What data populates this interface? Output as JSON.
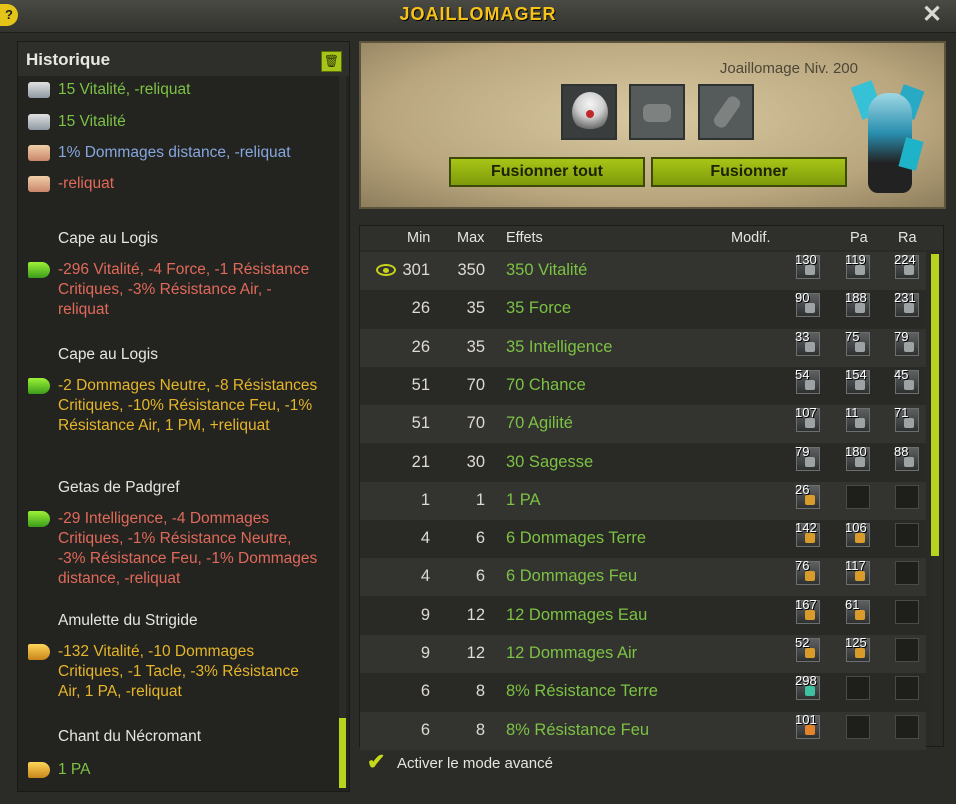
{
  "window": {
    "title": "JOAILLOMAGER",
    "help_icon": "?",
    "close_icon": "✕"
  },
  "history": {
    "title": "Historique",
    "trash_icon": "trash-icon",
    "entries": [
      {
        "icon": "rune-icon",
        "text": "15 Vitalité, -reliquat",
        "color": "#7cc244"
      },
      {
        "icon": "rune-icon",
        "text": "15 Vitalité",
        "color": "#7cc244"
      },
      {
        "icon": "rune-icon",
        "text": "1% Dommages distance, -reliquat",
        "color": "#86a7de"
      },
      {
        "icon": "rune-icon",
        "text": "-reliquat",
        "color": "#e06a5a"
      }
    ],
    "items": [
      {
        "title": "Cape au Logis",
        "text": "-296 Vitalité, -4 Force, -1 Résistance Critiques, -3% Résistance Air, -reliquat",
        "color": "#e06a5a"
      },
      {
        "title": "Cape au Logis",
        "text": "-2 Dommages Neutre, -8 Résistances Critiques, -10% Résistance Feu, -1% Résistance Air, 1 PM, +reliquat",
        "color": "#e5b52a"
      },
      {
        "title": "Getas de Padgref",
        "text": "-29 Intelligence, -4 Dommages Critiques, -1% Résistance Neutre, -3% Résistance Feu, -1% Dommages distance, -reliquat",
        "color": "#e06a5a"
      },
      {
        "title": "Amulette du Strigide",
        "text": "-132 Vitalité, -10 Dommages Critiques, -1 Tacle, -3% Résistance Air, 1 PA, -reliquat",
        "color": "#e5b52a"
      },
      {
        "title": "Chant du Nécromant",
        "text": "1 PA",
        "color": "#7cc244"
      }
    ]
  },
  "craft": {
    "level_label": "Joaillomage Niv. 200",
    "fuse_all_label": "Fusionner tout",
    "fuse_label": "Fusionner"
  },
  "effects": {
    "columns": {
      "min": "Min",
      "max": "Max",
      "effects": "Effets",
      "modif": "Modif.",
      "pa": "Pa",
      "ra": "Ra"
    },
    "rows": [
      {
        "min": "301",
        "max": "350",
        "effect": "350 Vitalité",
        "eye": true,
        "runes": [
          "130",
          "119",
          "224"
        ],
        "glyph": [
          "grey",
          "grey",
          "grey"
        ]
      },
      {
        "min": "26",
        "max": "35",
        "effect": "35 Force",
        "runes": [
          "90",
          "188",
          "231"
        ],
        "glyph": [
          "grey",
          "grey",
          "grey"
        ]
      },
      {
        "min": "26",
        "max": "35",
        "effect": "35 Intelligence",
        "runes": [
          "33",
          "75",
          "79"
        ],
        "glyph": [
          "grey",
          "grey",
          "grey"
        ]
      },
      {
        "min": "51",
        "max": "70",
        "effect": "70 Chance",
        "runes": [
          "54",
          "154",
          "45"
        ],
        "glyph": [
          "grey",
          "grey",
          "grey"
        ]
      },
      {
        "min": "51",
        "max": "70",
        "effect": "70 Agilité",
        "runes": [
          "107",
          "11",
          "71"
        ],
        "glyph": [
          "grey",
          "grey",
          "grey"
        ]
      },
      {
        "min": "21",
        "max": "30",
        "effect": "30 Sagesse",
        "runes": [
          "79",
          "180",
          "88"
        ],
        "glyph": [
          "grey",
          "grey",
          "grey"
        ]
      },
      {
        "min": "1",
        "max": "1",
        "effect": "1 PA",
        "runes": [
          "26",
          "",
          ""
        ],
        "glyph": [
          "gold",
          "",
          ""
        ]
      },
      {
        "min": "4",
        "max": "6",
        "effect": "6 Dommages Terre",
        "runes": [
          "142",
          "106",
          ""
        ],
        "glyph": [
          "gold",
          "gold",
          ""
        ]
      },
      {
        "min": "4",
        "max": "6",
        "effect": "6 Dommages Feu",
        "runes": [
          "76",
          "117",
          ""
        ],
        "glyph": [
          "gold",
          "gold",
          ""
        ]
      },
      {
        "min": "9",
        "max": "12",
        "effect": "12 Dommages Eau",
        "runes": [
          "167",
          "61",
          ""
        ],
        "glyph": [
          "gold",
          "gold",
          ""
        ]
      },
      {
        "min": "9",
        "max": "12",
        "effect": "12 Dommages Air",
        "runes": [
          "52",
          "125",
          ""
        ],
        "glyph": [
          "gold",
          "gold",
          ""
        ]
      },
      {
        "min": "6",
        "max": "8",
        "effect": "8% Résistance Terre",
        "runes": [
          "298",
          "",
          ""
        ],
        "glyph": [
          "teal",
          "",
          ""
        ]
      },
      {
        "min": "6",
        "max": "8",
        "effect": "8% Résistance Feu",
        "runes": [
          "101",
          "",
          ""
        ],
        "glyph": [
          "orange",
          "",
          ""
        ]
      }
    ]
  },
  "advanced_mode": {
    "label": "Activer le mode avancé",
    "checked": true
  }
}
